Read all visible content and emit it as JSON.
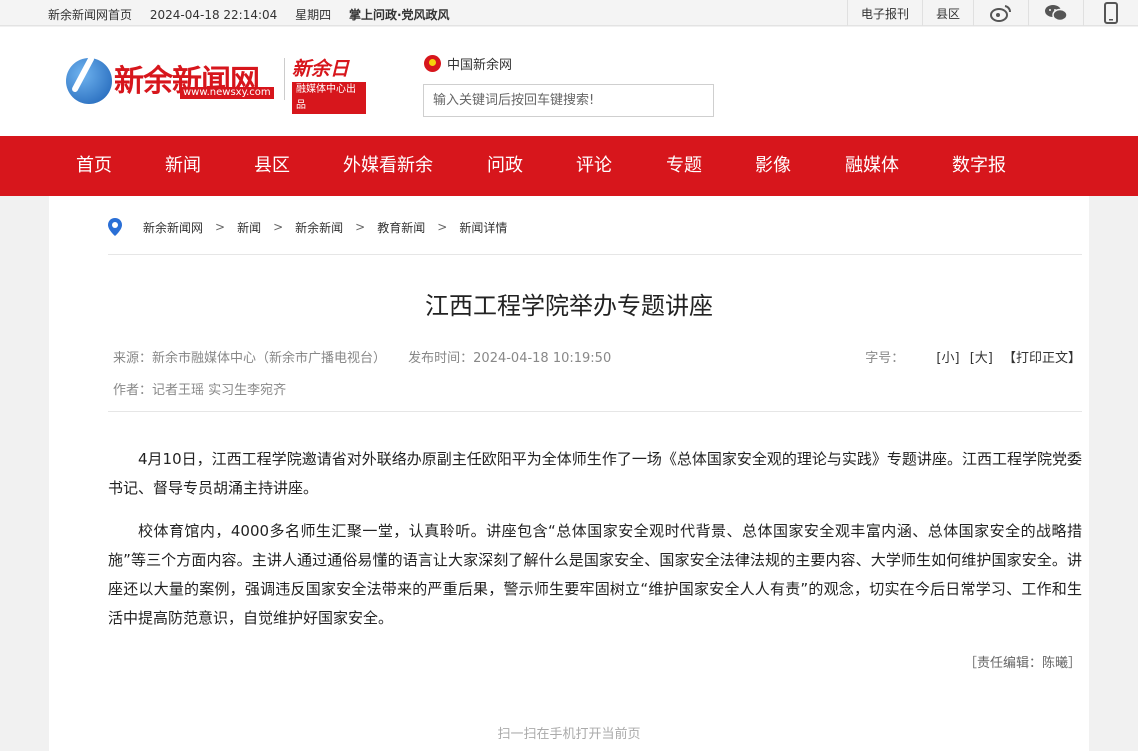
{
  "topbar": {
    "home_link": "新余新闻网首页",
    "datetime": "2024-04-18 22:14:04",
    "weekday": "星期四",
    "highlight": "掌上问政·党风政风",
    "epaper": "电子报刊",
    "county": "县区"
  },
  "header": {
    "logo_name": "新余新闻网",
    "logo_url": "www.newsxy.com",
    "daily_name": "新余日报",
    "daily_tagline": "融媒体中心出品",
    "site_link": "中国新余网",
    "search_placeholder": "输入关键词后按回车键搜索!"
  },
  "nav": [
    "首页",
    "新闻",
    "县区",
    "外媒看新余",
    "问政",
    "评论",
    "专题",
    "影像",
    "融媒体",
    "数字报"
  ],
  "breadcrumb": [
    "新余新闻网",
    "新闻",
    "新余新闻",
    "教育新闻",
    "新闻详情"
  ],
  "article": {
    "title": "江西工程学院举办专题讲座",
    "source": "来源：新余市融媒体中心（新余市广播电视台）",
    "publish_time": "发布时间：2024-04-18 10:19:50",
    "font_label": "字号：",
    "font_small": "[小]",
    "font_large": "[大]",
    "print": "【打印正文】",
    "author": "作者：记者王瑶 实习生李宛齐",
    "paragraphs": [
      "4月10日，江西工程学院邀请省对外联络办原副主任欧阳平为全体师生作了一场《总体国家安全观的理论与实践》专题讲座。江西工程学院党委书记、督导专员胡涌主持讲座。",
      "校体育馆内，4000多名师生汇聚一堂，认真聆听。讲座包含“总体国家安全观时代背景、总体国家安全观丰富内涵、总体国家安全的战略措施”等三个方面内容。主讲人通过通俗易懂的语言让大家深刻了解什么是国家安全、国家安全法律法规的主要内容、大学师生如何维护国家安全。讲座还以大量的案例，强调违反国家安全法带来的严重后果，警示师生要牢固树立“维护国家安全人人有责”的观念，切实在今后日常学习、工作和生活中提高防范意识，自觉维护好国家安全。"
    ],
    "editor": "［责任编辑：陈曦］",
    "qr_hint": "扫一扫在手机打开当前页"
  },
  "colors": {
    "brand_red": "#d7161c"
  }
}
